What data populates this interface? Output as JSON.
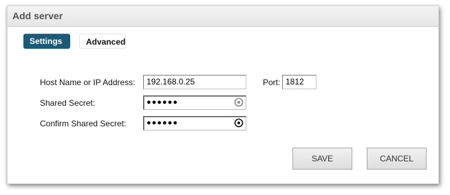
{
  "dialog": {
    "title": "Add server"
  },
  "tabs": [
    {
      "label": "Settings",
      "active": true
    },
    {
      "label": "Advanced",
      "active": false
    }
  ],
  "form": {
    "host_label": "Host Name or IP Address:",
    "host_value": "192.168.0.25",
    "port_label": "Port:",
    "port_value": "1812",
    "secret_label": "Shared Secret:",
    "secret_value": "●●●●●●",
    "confirm_label": "Confirm Shared Secret:",
    "confirm_value": "●●●●●●"
  },
  "buttons": {
    "save": "SAVE",
    "cancel": "CANCEL"
  },
  "icons": {
    "secret_reveal": "reveal-password-icon",
    "confirm_reveal": "reveal-password-icon"
  },
  "colors": {
    "tab_active_bg": "#1b5b78",
    "title_text": "#555555"
  }
}
